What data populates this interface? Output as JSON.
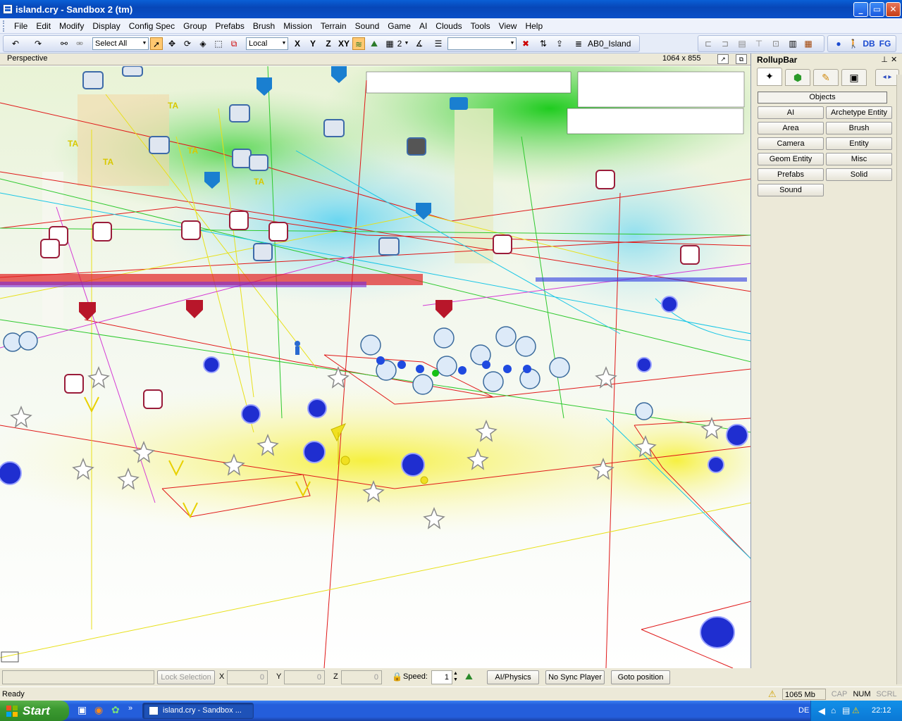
{
  "window": {
    "title": "island.cry - Sandbox 2 (tm)",
    "min": "_",
    "max": "▭",
    "close": "✕"
  },
  "menus": [
    "File",
    "Edit",
    "Modify",
    "Display",
    "Config Spec",
    "Group",
    "Prefabs",
    "Brush",
    "Mission",
    "Terrain",
    "Sound",
    "Game",
    "AI",
    "Clouds",
    "Tools",
    "View",
    "Help"
  ],
  "toolbar": {
    "selection_combo": "Select All",
    "coord_combo": "Local",
    "axis_x": "X",
    "axis_y": "Y",
    "axis_z": "Z",
    "axis_xy": "XY",
    "grid_value": "2",
    "level_name": "AB0_Island",
    "right_db": "DB",
    "right_fg": "FG"
  },
  "viewport": {
    "label": "Perspective",
    "resolution": "1064 x 855"
  },
  "rollup": {
    "title": "RollupBar",
    "pin": " ⊥",
    "close": "✕",
    "section_title": "Objects",
    "buttons": [
      "AI",
      "Archetype Entity",
      "Area",
      "Brush",
      "Camera",
      "Entity",
      "Geom Entity",
      "Misc",
      "Prefabs",
      "Solid",
      "Sound"
    ]
  },
  "bottom": {
    "lock_selection": "Lock Selection",
    "x_label": "X",
    "x_value": "0",
    "y_label": "Y",
    "y_value": "0",
    "z_label": "Z",
    "z_value": "0",
    "speed_label": "Speed:",
    "speed_value": "1",
    "ai_physics": "AI/Physics",
    "no_sync": "No Sync Player",
    "goto": "Goto position"
  },
  "status": {
    "text": "Ready",
    "memory": "1065 Mb",
    "cap": "CAP",
    "num": "NUM",
    "scrl": "SCRL"
  },
  "taskbar": {
    "start": "Start",
    "task": "island.cry - Sandbox ...",
    "lang": "DE",
    "clock": "22:12",
    "chevron": "»"
  },
  "colors": {
    "titlebar": "#0a4fc7",
    "ground_yellow": "#f4f060",
    "canopy_green": "#3fd12f",
    "selection_red": "#e01818",
    "entity_blue": "#1f2ed0"
  }
}
